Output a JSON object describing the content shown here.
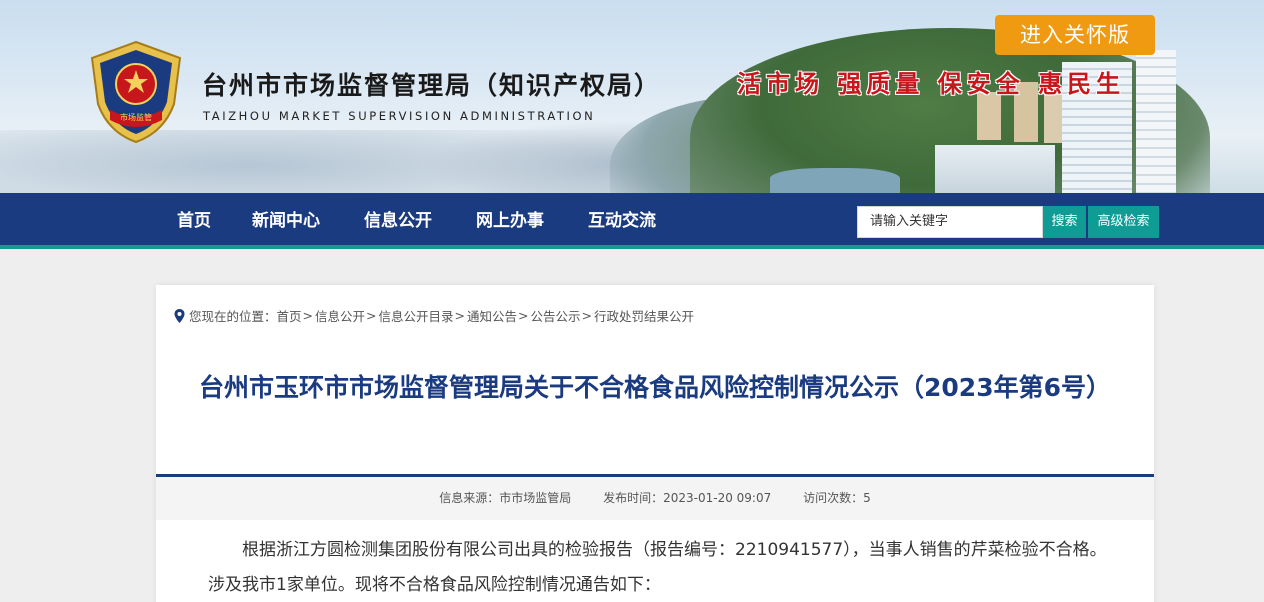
{
  "header": {
    "site_title": "台州市市场监督管理局（知识产权局）",
    "site_subtitle": "TAIZHOU MARKET SUPERVISION ADMINISTRATION",
    "slogan": "活市场  强质量  保安全  惠民生",
    "care_button": "进入关怀版",
    "emblem_text": "市场监管",
    "emblem_icon": "police-badge-emblem"
  },
  "nav": {
    "items": [
      "首页",
      "新闻中心",
      "信息公开",
      "网上办事",
      "互动交流"
    ],
    "search_placeholder": "请输入关键字",
    "search_button": "搜索",
    "advanced_search_button": "高级检索"
  },
  "breadcrumb": {
    "prefix": "您现在的位置：",
    "items": [
      "首页",
      "信息公开",
      "信息公开目录",
      "通知公告",
      "公告公示",
      "行政处罚结果公开"
    ],
    "icon": "location-pin-icon"
  },
  "article": {
    "title": "台州市玉环市市场监督管理局关于不合格食品风险控制情况公示（2023年第6号）",
    "source": "信息来源：市市场监管局",
    "publish_time": "发布时间：2023-01-20 09:07",
    "views": "访问次数：5",
    "body": "根据浙江方圆检测集团股份有限公司出具的检验报告（报告编号：2210941577），当事人销售的芹菜检验不合格。涉及我市1家单位。现将不合格食品风险控制情况通告如下："
  },
  "colors": {
    "nav_bg": "#1b3b80",
    "accent_teal": "#0f9c95",
    "care_orange": "#ef9a10",
    "slogan_red": "#c8161d"
  }
}
